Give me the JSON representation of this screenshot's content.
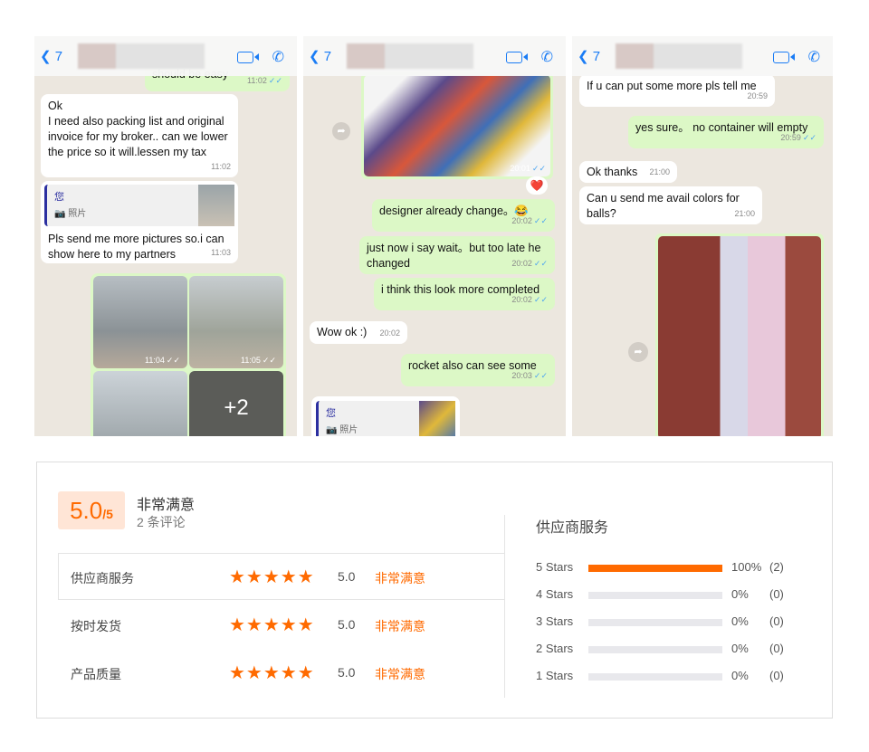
{
  "chats": [
    {
      "back": "7",
      "messages": [
        {
          "text": "should  be easy",
          "time": "11:02"
        },
        {
          "text": "Ok\nI need also packing list and original invoice for my broker.. can we lower the price so it will.lessen my tax",
          "time": "11:02"
        },
        {
          "quote_author": "您",
          "quote_type": "照片",
          "text": "Pls send me more pictures so.i can show here to my partners",
          "time": "11:03"
        },
        {
          "photo_time_1": "11:04",
          "photo_time_2": "11:05",
          "more": "+2"
        }
      ]
    },
    {
      "back": "7",
      "messages": [
        {
          "photo_time": "20:01",
          "reaction": "❤️"
        },
        {
          "text": "designer already change。😂",
          "time": "20:02"
        },
        {
          "text": "just now i say wait。but too late he changed",
          "time": "20:02"
        },
        {
          "text": "i think this look more completed",
          "time": "20:02"
        },
        {
          "text": "Wow ok :)",
          "time": "20:02"
        },
        {
          "text": "rocket also can see some",
          "time": "20:03"
        },
        {
          "quote_author": "您",
          "quote_type": "照片"
        }
      ]
    },
    {
      "back": "7",
      "messages": [
        {
          "text": "If u can put some more pls tell me",
          "time": "20:59"
        },
        {
          "text": "yes sure。 no container will empty",
          "time": "20:59"
        },
        {
          "text": "Ok thanks",
          "time": "21:00"
        },
        {
          "text": "Can u send me avail colors for balls?",
          "time": "21:00"
        }
      ]
    }
  ],
  "rating": {
    "score": "5.0",
    "out_of": "/5",
    "label": "非常满意",
    "count": "2 条评论",
    "rows": [
      {
        "name": "供应商服务",
        "score": "5.0",
        "label": "非常满意",
        "stars": 5
      },
      {
        "name": "按时发货",
        "score": "5.0",
        "label": "非常满意",
        "stars": 5
      },
      {
        "name": "产品质量",
        "score": "5.0",
        "label": "非常满意",
        "stars": 5
      }
    ],
    "dist_title": "供应商服务",
    "dist": [
      {
        "label": "5 Stars",
        "pct": "100%",
        "count": "(2)",
        "value": 100
      },
      {
        "label": "4 Stars",
        "pct": "0%",
        "count": "(0)",
        "value": 0
      },
      {
        "label": "3 Stars",
        "pct": "0%",
        "count": "(0)",
        "value": 0
      },
      {
        "label": "2 Stars",
        "pct": "0%",
        "count": "(0)",
        "value": 0
      },
      {
        "label": "1 Stars",
        "pct": "0%",
        "count": "(0)",
        "value": 0
      }
    ]
  },
  "colors": {
    "accent": "#ff6a00",
    "bubble_out": "#dcf8c6",
    "link": "#1a7cf5"
  }
}
